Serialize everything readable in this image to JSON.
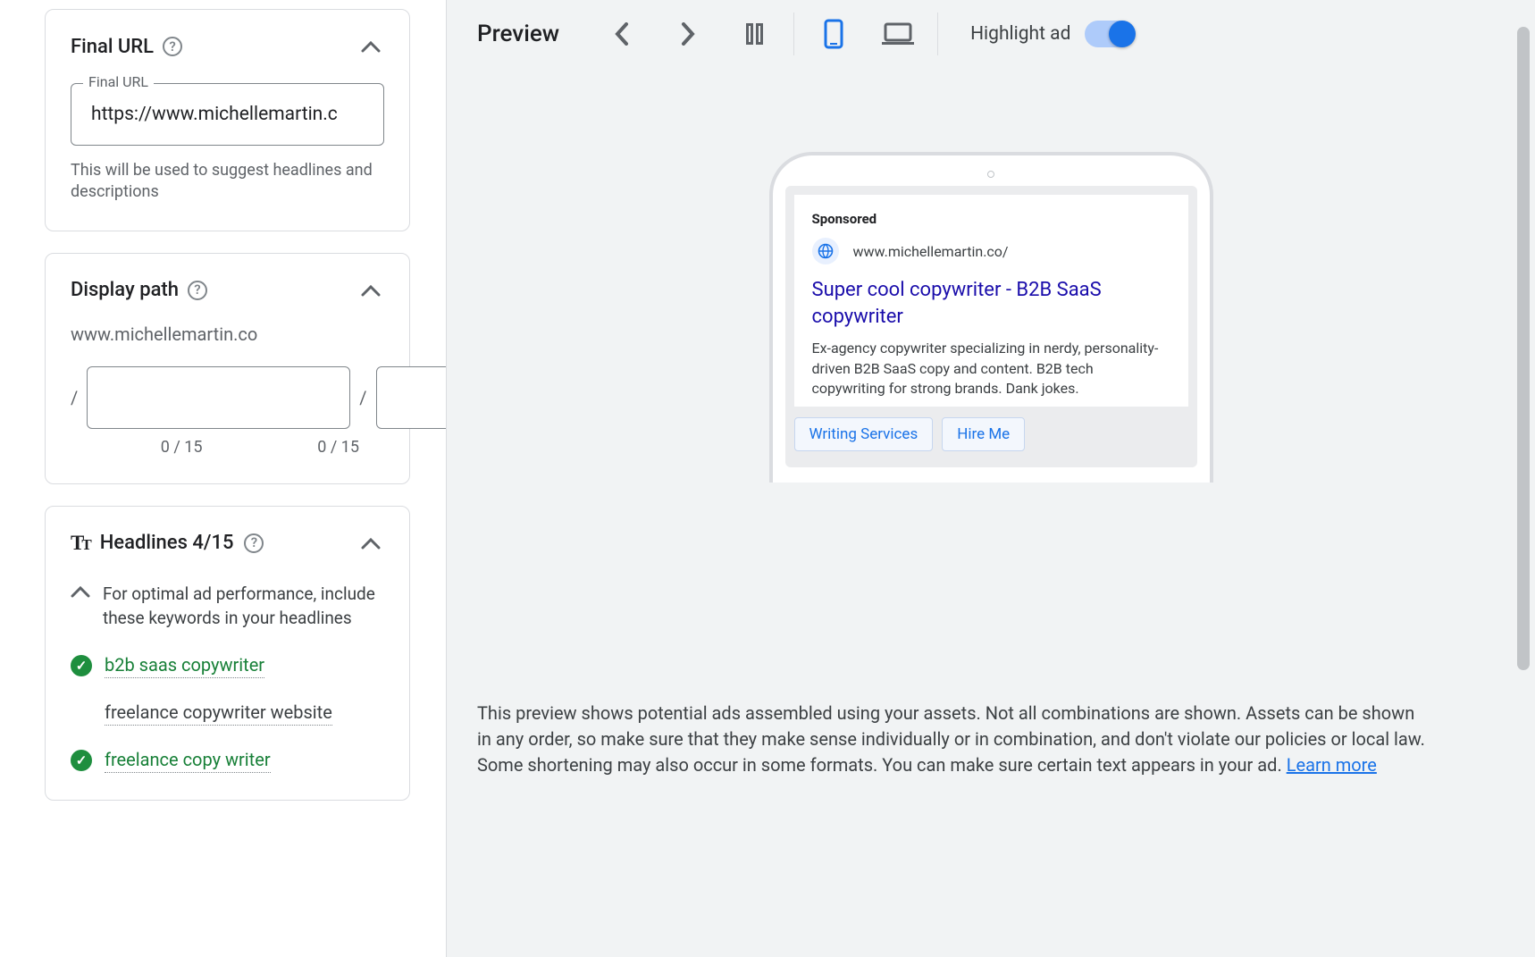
{
  "finalUrl": {
    "section_title": "Final URL",
    "label": "Final URL",
    "value": "https://www.michellemartin.c",
    "helper": "This will be used to suggest headlines and descriptions"
  },
  "displayPath": {
    "section_title": "Display path",
    "base": "www.michellemartin.co",
    "path1_value": "",
    "path2_value": "",
    "count1": "0 / 15",
    "count2": "0 / 15"
  },
  "headlines": {
    "section_title": "Headlines 4/15",
    "hint": "For optimal ad performance, include these keywords in your headlines",
    "keywords": [
      {
        "text": "b2b saas copywriter",
        "checked": true
      },
      {
        "text": "freelance copywriter website",
        "checked": false
      },
      {
        "text": "freelance copy writer",
        "checked": true
      }
    ]
  },
  "preview": {
    "title": "Preview",
    "highlight_label": "Highlight ad",
    "highlight_on": true,
    "active_device": "mobile",
    "sponsored_label": "Sponsored",
    "display_url": "www.michellemartin.co/",
    "ad_title": "Super cool copywriter - B2B SaaS copywriter",
    "ad_desc": "Ex-agency copywriter specializing in nerdy, personality-driven B2B SaaS copy and content. B2B tech copywriting for strong brands. Dank jokes.",
    "sitelinks": [
      "Writing Services",
      "Hire Me"
    ],
    "footer": "This preview shows potential ads assembled using your assets. Not all combinations are shown. Assets can be shown in any order, so make sure that they make sense individually or in combination, and don't violate our policies or local law. Some shortening may also occur in some formats. You can make sure certain text appears in your ad. ",
    "learn_more": "Learn more"
  }
}
